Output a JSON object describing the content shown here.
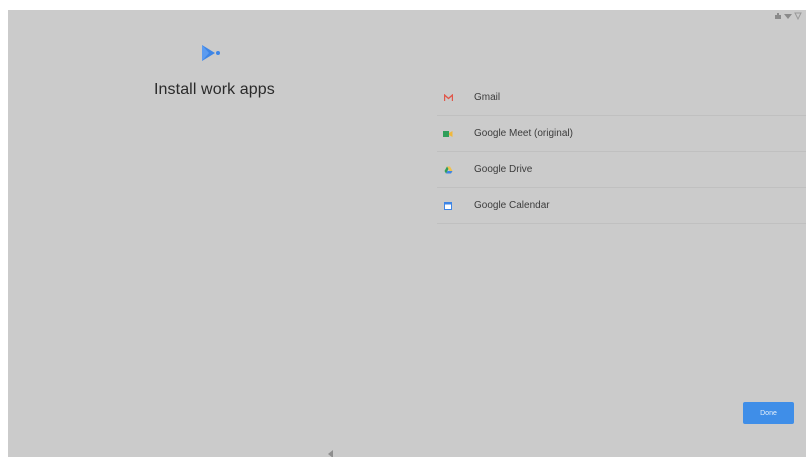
{
  "header": {
    "title": "Install work apps"
  },
  "apps": [
    {
      "label": "Gmail",
      "icon": "gmail-icon"
    },
    {
      "label": "Google Meet (original)",
      "icon": "google-meet-icon"
    },
    {
      "label": "Google Drive",
      "icon": "google-drive-icon"
    },
    {
      "label": "Google Calendar",
      "icon": "google-calendar-icon"
    }
  ],
  "footer": {
    "done_label": "Done"
  },
  "colors": {
    "background": "#cbcbcb",
    "accent": "#3f8ee8",
    "play_logo": "#3d85e6"
  }
}
